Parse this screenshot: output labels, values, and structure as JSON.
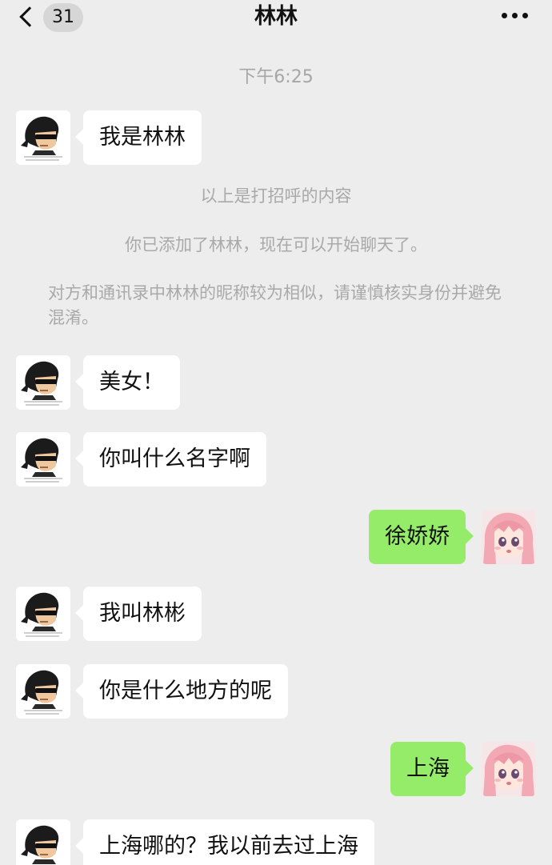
{
  "header": {
    "back_badge": "31",
    "title": "林林"
  },
  "timestamp": "下午6:25",
  "messages": [
    {
      "text": "我是林林"
    },
    {
      "text": "美女！"
    },
    {
      "text": "你叫什么名字啊"
    },
    {
      "text": "徐娇娇"
    },
    {
      "text": "我叫林彬"
    },
    {
      "text": "你是什么地方的呢"
    },
    {
      "text": "上海"
    },
    {
      "text": "上海哪的？我以前去过上海"
    }
  ],
  "system_notes": {
    "greeting_note": "以上是打招呼的内容",
    "added_note": "你已添加了林林，现在可以开始聊天了。",
    "similar_name_warning": "对方和通讯录中林林的昵称较为相似，请谨慎核实身份并避免混淆。"
  }
}
